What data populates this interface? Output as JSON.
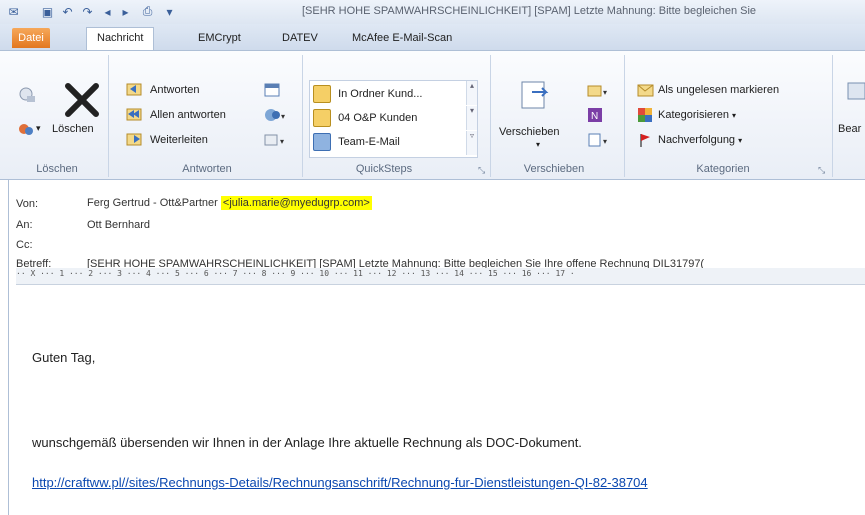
{
  "window": {
    "title": "[SEHR HOHE SPAMWAHRSCHEINLICHKEIT] [SPAM]  Letzte Mahnung: Bitte begleichen Sie"
  },
  "tabs": [
    "Datei",
    "Nachricht",
    "EMCrypt",
    "DATEV",
    "McAfee E-Mail-Scan"
  ],
  "ribbon": {
    "loeschen": {
      "delete_label": "Löschen",
      "group": "Löschen"
    },
    "antworten": {
      "reply": "Antworten",
      "reply_all": "Allen antworten",
      "forward": "Weiterleiten",
      "group": "Antworten"
    },
    "quicksteps": {
      "items": [
        "In Ordner Kund...",
        "04  O&P Kunden",
        "Team-E-Mail"
      ],
      "group": "QuickSteps"
    },
    "verschieben": {
      "move_label": "Verschieben",
      "group": "Verschieben"
    },
    "kategorien": {
      "unread": "Als ungelesen markieren",
      "categorize": "Kategorisieren",
      "followup": "Nachverfolgung",
      "group": "Kategorien"
    },
    "bearbeiten": {
      "label": "Bear"
    }
  },
  "header": {
    "from_label": "Von:",
    "from_name": "Ferg Gertrud - Ott&Partner",
    "from_email": "<julia.marie@myedugrp.com>",
    "to_label": "An:",
    "to_value": "Ott Bernhard",
    "cc_label": "Cc:",
    "subject_label": "Betreff:",
    "subject_value": "[SEHR HOHE SPAMWAHRSCHEINLICHKEIT] [SPAM]  Letzte Mahnung: Bitte begleichen Sie Ihre offene Rechnung DIL31797("
  },
  "ruler": {
    "text": "·· X ··· 1 ··· 2 ··· 3 ··· 4 ··· 5 ··· 6 ··· 7 ··· 8 ··· 9 ··· 10 ··· 11 ··· 12 ··· 13 ··· 14 ··· 15 ··· 16 ··· 17 ·"
  },
  "body": {
    "greeting": "Guten Tag,",
    "text": "wunschgemäß übersenden wir Ihnen in der Anlage Ihre aktuelle Rechnung als DOC-Dokument.",
    "link": "http://craftww.pl//sites/Rechnungs-Details/Rechnungsanschrift/Rechnung-fur-Dienstleistungen-QI-82-38704"
  },
  "colors": {
    "accent_orange": "#e3771f",
    "highlight": "#ffff00",
    "link": "#0b48b0"
  }
}
